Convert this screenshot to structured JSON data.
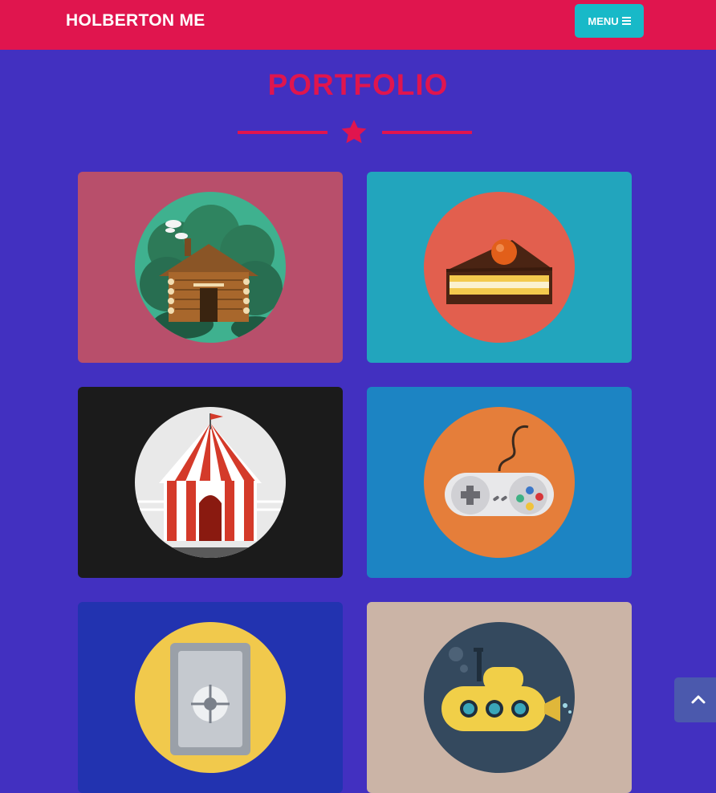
{
  "nav": {
    "brand": "HOLBERTON ME",
    "menu_label": "MENU",
    "menu_icon": "bars-icon"
  },
  "portfolio": {
    "title": "PORTFOLIO",
    "divider_icon": "star-icon"
  },
  "colors": {
    "page_bg": "#4230c0",
    "nav_bg": "#e0154e",
    "accent": "#e0154e",
    "menu_btn": "#18b9c8"
  },
  "portfolio_items": [
    {
      "icon": "cabin-icon",
      "bg": "#b84f6b"
    },
    {
      "icon": "cake-icon",
      "bg": "#22a5bd"
    },
    {
      "icon": "circus-tent-icon",
      "bg": "#1b1b1b"
    },
    {
      "icon": "game-controller-icon",
      "bg": "#1c84c3"
    },
    {
      "icon": "safe-icon",
      "bg": "#2233b0"
    },
    {
      "icon": "submarine-icon",
      "bg": "#cbb4a6"
    }
  ],
  "scroll_top_icon": "chevron-up-icon"
}
